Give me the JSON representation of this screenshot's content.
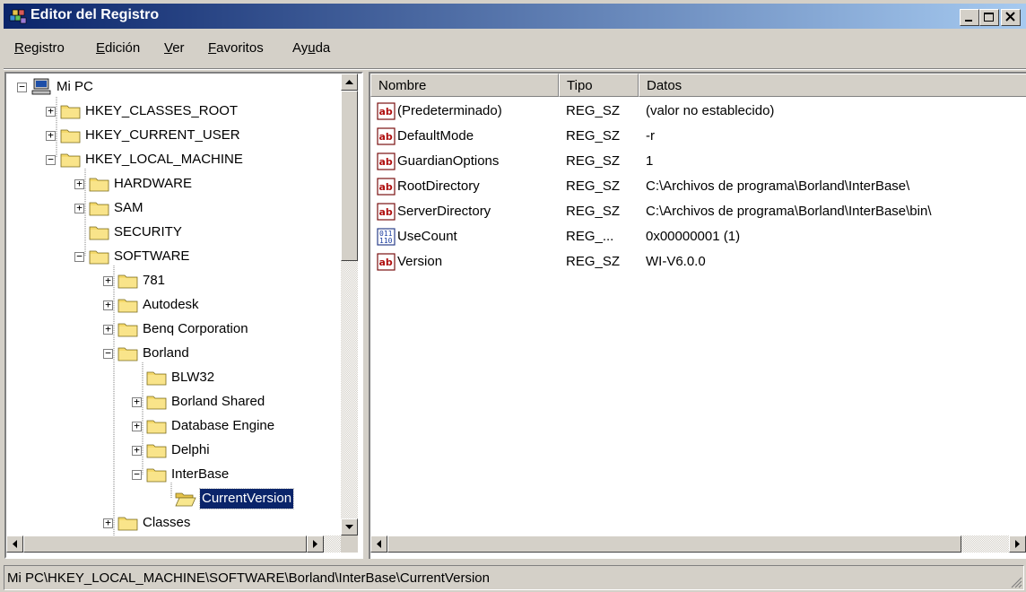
{
  "window": {
    "title": "Editor del Registro"
  },
  "menu": {
    "items": [
      {
        "label": "Registro",
        "key": "R"
      },
      {
        "label": "Edición",
        "key": "E"
      },
      {
        "label": "Ver",
        "key": "V"
      },
      {
        "label": "Favoritos",
        "key": "F"
      },
      {
        "label": "Ayuda",
        "key": "u"
      }
    ]
  },
  "tree": {
    "nodes": [
      {
        "label": "Mi PC",
        "icon": "computer-icon",
        "expanded": true
      },
      {
        "label": "HKEY_CLASSES_ROOT",
        "icon": "folder-icon",
        "expanded": false
      },
      {
        "label": "HKEY_CURRENT_USER",
        "icon": "folder-icon",
        "expanded": false
      },
      {
        "label": "HKEY_LOCAL_MACHINE",
        "icon": "folder-icon",
        "expanded": true
      },
      {
        "label": "HARDWARE",
        "icon": "folder-icon",
        "expanded": false
      },
      {
        "label": "SAM",
        "icon": "folder-icon",
        "expanded": false
      },
      {
        "label": "SECURITY",
        "icon": "folder-icon"
      },
      {
        "label": "SOFTWARE",
        "icon": "folder-icon",
        "expanded": true
      },
      {
        "label": "781",
        "icon": "folder-icon",
        "expanded": false
      },
      {
        "label": "Autodesk",
        "icon": "folder-icon",
        "expanded": false
      },
      {
        "label": "Benq Corporation",
        "icon": "folder-icon",
        "expanded": false
      },
      {
        "label": "Borland",
        "icon": "folder-icon",
        "expanded": true
      },
      {
        "label": "BLW32",
        "icon": "folder-icon"
      },
      {
        "label": "Borland Shared",
        "icon": "folder-icon",
        "expanded": false
      },
      {
        "label": "Database Engine",
        "icon": "folder-icon",
        "expanded": false
      },
      {
        "label": "Delphi",
        "icon": "folder-icon",
        "expanded": false
      },
      {
        "label": "InterBase",
        "icon": "folder-icon",
        "expanded": true
      },
      {
        "label": "CurrentVersion",
        "icon": "open-folder-icon",
        "selected": true
      },
      {
        "label": "Classes",
        "icon": "folder-icon",
        "expanded": false
      }
    ]
  },
  "list": {
    "columns": [
      "Nombre",
      "Tipo",
      "Datos"
    ],
    "rows": [
      {
        "icon": "string-value-icon",
        "name": "(Predeterminado)",
        "type": "REG_SZ",
        "data": "(valor no establecido)"
      },
      {
        "icon": "string-value-icon",
        "name": "DefaultMode",
        "type": "REG_SZ",
        "data": "-r"
      },
      {
        "icon": "string-value-icon",
        "name": "GuardianOptions",
        "type": "REG_SZ",
        "data": "1"
      },
      {
        "icon": "string-value-icon",
        "name": "RootDirectory",
        "type": "REG_SZ",
        "data": "C:\\Archivos de programa\\Borland\\InterBase\\"
      },
      {
        "icon": "string-value-icon",
        "name": "ServerDirectory",
        "type": "REG_SZ",
        "data": "C:\\Archivos de programa\\Borland\\InterBase\\bin\\"
      },
      {
        "icon": "binary-value-icon",
        "name": "UseCount",
        "type": "REG_...",
        "data": "0x00000001 (1)"
      },
      {
        "icon": "string-value-icon",
        "name": "Version",
        "type": "REG_SZ",
        "data": "WI-V6.0.0"
      }
    ]
  },
  "statusbar": {
    "text": "Mi PC\\HKEY_LOCAL_MACHINE\\SOFTWARE\\Borland\\InterBase\\CurrentVersion"
  },
  "colors": {
    "titlebar_start": "#0a246a",
    "titlebar_end": "#a6caf0",
    "selection": "#0a246a",
    "face": "#d4d0c8"
  }
}
